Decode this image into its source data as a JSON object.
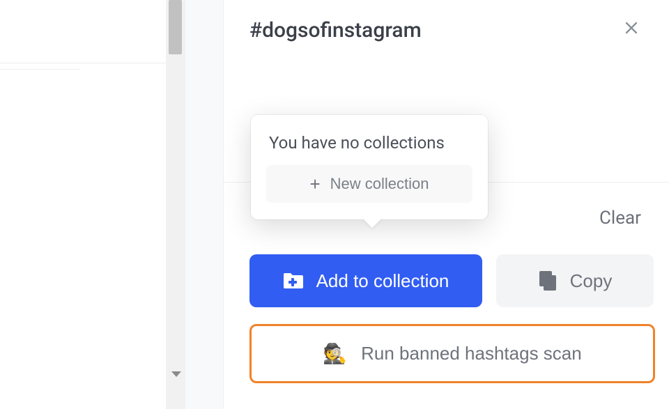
{
  "hashtag": "#dogsofinstagram",
  "popover": {
    "title": "You have no collections",
    "new_label": "New collection"
  },
  "actions": {
    "clear": "Clear",
    "add_to_collection": "Add to collection",
    "copy": "Copy",
    "scan": "Run banned hashtags scan"
  }
}
